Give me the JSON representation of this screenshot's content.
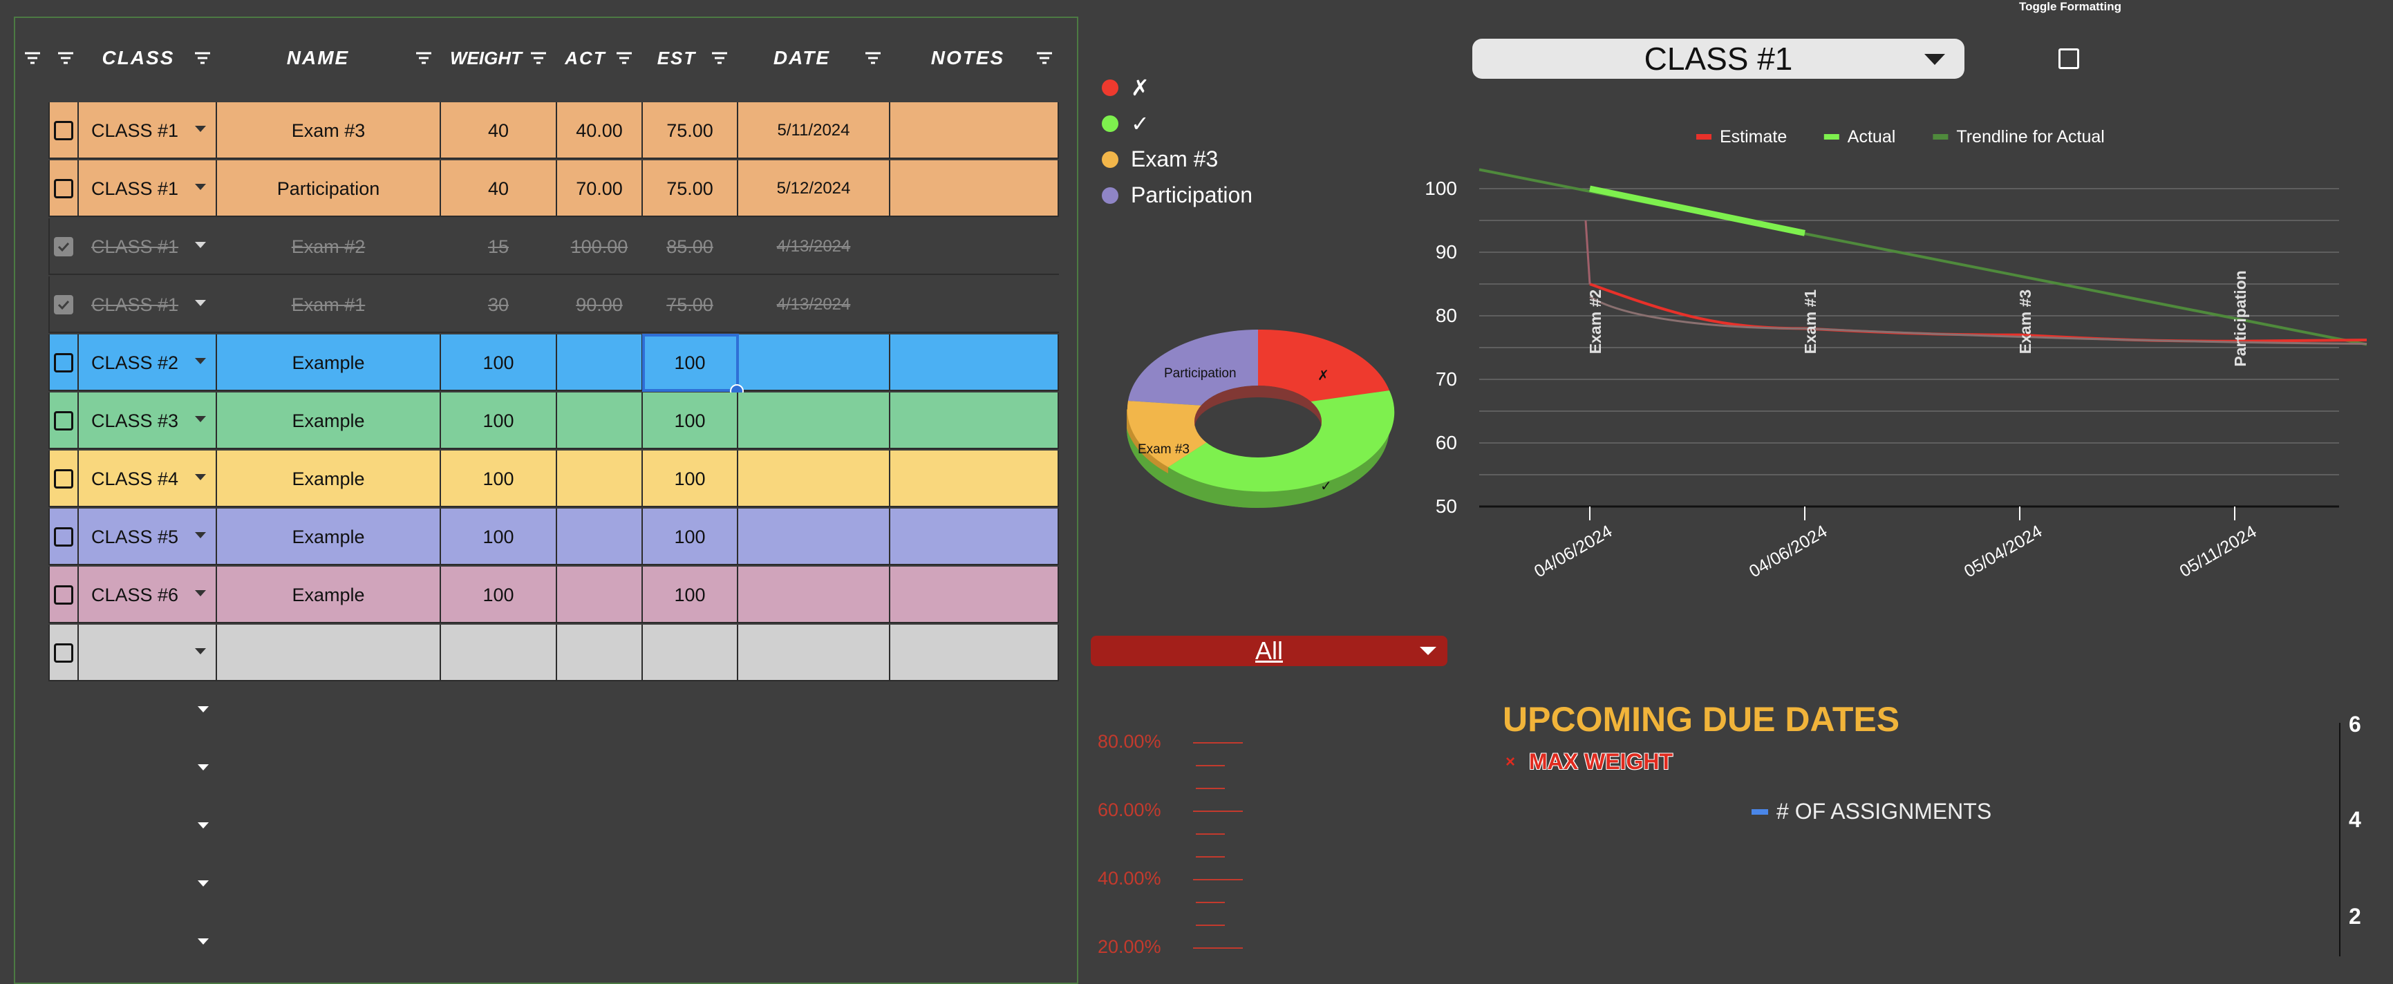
{
  "header": {
    "columns": [
      "CLASS",
      "NAME",
      "WEIGHT",
      "ACT",
      "EST",
      "DATE",
      "NOTES"
    ]
  },
  "rows": [
    {
      "checked": false,
      "class": "CLASS #1",
      "name": "Exam #3",
      "weight": "40",
      "act": "40.00",
      "est": "75.00",
      "date": "5/11/2024",
      "notes": "",
      "color": "#ecb17a",
      "done": false
    },
    {
      "checked": false,
      "class": "CLASS #1",
      "name": "Participation",
      "weight": "40",
      "act": "70.00",
      "est": "75.00",
      "date": "5/12/2024",
      "notes": "",
      "color": "#ecb17a",
      "done": false
    },
    {
      "checked": true,
      "class": "CLASS #1",
      "name": "Exam #2",
      "weight": "15",
      "act": "100.00",
      "est": "85.00",
      "date": "4/13/2024",
      "notes": "",
      "color": "#3e3e3e",
      "done": true
    },
    {
      "checked": true,
      "class": "CLASS #1",
      "name": "Exam #1",
      "weight": "30",
      "act": "90.00",
      "est": "75.00",
      "date": "4/13/2024",
      "notes": "",
      "color": "#3e3e3e",
      "done": true
    },
    {
      "checked": false,
      "class": "CLASS #2",
      "name": "Example",
      "weight": "100",
      "act": "",
      "est": "100",
      "date": "",
      "notes": "",
      "color": "#4bb0f3",
      "done": false
    },
    {
      "checked": false,
      "class": "CLASS #3",
      "name": "Example",
      "weight": "100",
      "act": "",
      "est": "100",
      "date": "",
      "notes": "",
      "color": "#80cf9b",
      "done": false
    },
    {
      "checked": false,
      "class": "CLASS #4",
      "name": "Example",
      "weight": "100",
      "act": "",
      "est": "100",
      "date": "",
      "notes": "",
      "color": "#f9d77d",
      "done": false
    },
    {
      "checked": false,
      "class": "CLASS #5",
      "name": "Example",
      "weight": "100",
      "act": "",
      "est": "100",
      "date": "",
      "notes": "",
      "color": "#a0a5e0",
      "done": false
    },
    {
      "checked": false,
      "class": "CLASS #6",
      "name": "Example",
      "weight": "100",
      "act": "",
      "est": "100",
      "date": "",
      "notes": "",
      "color": "#d0a4bb",
      "done": false
    },
    {
      "checked": false,
      "class": "",
      "name": "",
      "weight": "",
      "act": "",
      "est": "",
      "date": "",
      "notes": "",
      "color": "#d0d0d0",
      "done": false
    }
  ],
  "donut_legend": [
    {
      "label": "✗",
      "color": "#ee3a2e"
    },
    {
      "label": "✓",
      "color": "#7ef04e"
    },
    {
      "label": "Exam #3",
      "color": "#f2b64a"
    },
    {
      "label": "Participation",
      "color": "#8f85c6"
    }
  ],
  "donut_labels": {
    "x": "✗",
    "check": "✓",
    "exam3": "Exam #3",
    "participation": "Participation"
  },
  "class_select": {
    "value": "CLASS #1"
  },
  "toggle": {
    "label": "Toggle Formatting",
    "checked": false
  },
  "filter_select": {
    "value": "All"
  },
  "upcoming": {
    "title": "UPCOMING DUE DATES",
    "max_weight": "MAX WEIGHT",
    "n_assignments": "# OF ASSIGNMENTS",
    "percent_ticks": [
      "80.00%",
      "60.00%",
      "40.00%",
      "20.00%"
    ],
    "right_ticks": [
      "6",
      "4",
      "2"
    ]
  },
  "chart_data": {
    "type": "line",
    "title": "",
    "legend": [
      {
        "name": "Estimate",
        "color": "#e8312a"
      },
      {
        "name": "Actual",
        "color": "#7ef04e"
      },
      {
        "name": "Trendline for Actual",
        "color": "#4f8a3c"
      }
    ],
    "x_tick_labels": [
      "04/06/2024",
      "04/06/2024",
      "05/04/2024",
      "05/11/2024"
    ],
    "point_labels": [
      "Exam #2",
      "Exam #1",
      "Exam #3",
      "Participation"
    ],
    "ylim": [
      50,
      100
    ],
    "y_ticks": [
      50,
      60,
      70,
      80,
      90,
      100
    ],
    "series": [
      {
        "name": "Estimate",
        "values": [
          85,
          78,
          77,
          76
        ]
      },
      {
        "name": "Actual",
        "values": [
          100,
          93
        ]
      },
      {
        "name": "Trendline for Actual",
        "values": [
          103,
          75.5
        ]
      }
    ],
    "legend_position": "top",
    "grid": true
  }
}
